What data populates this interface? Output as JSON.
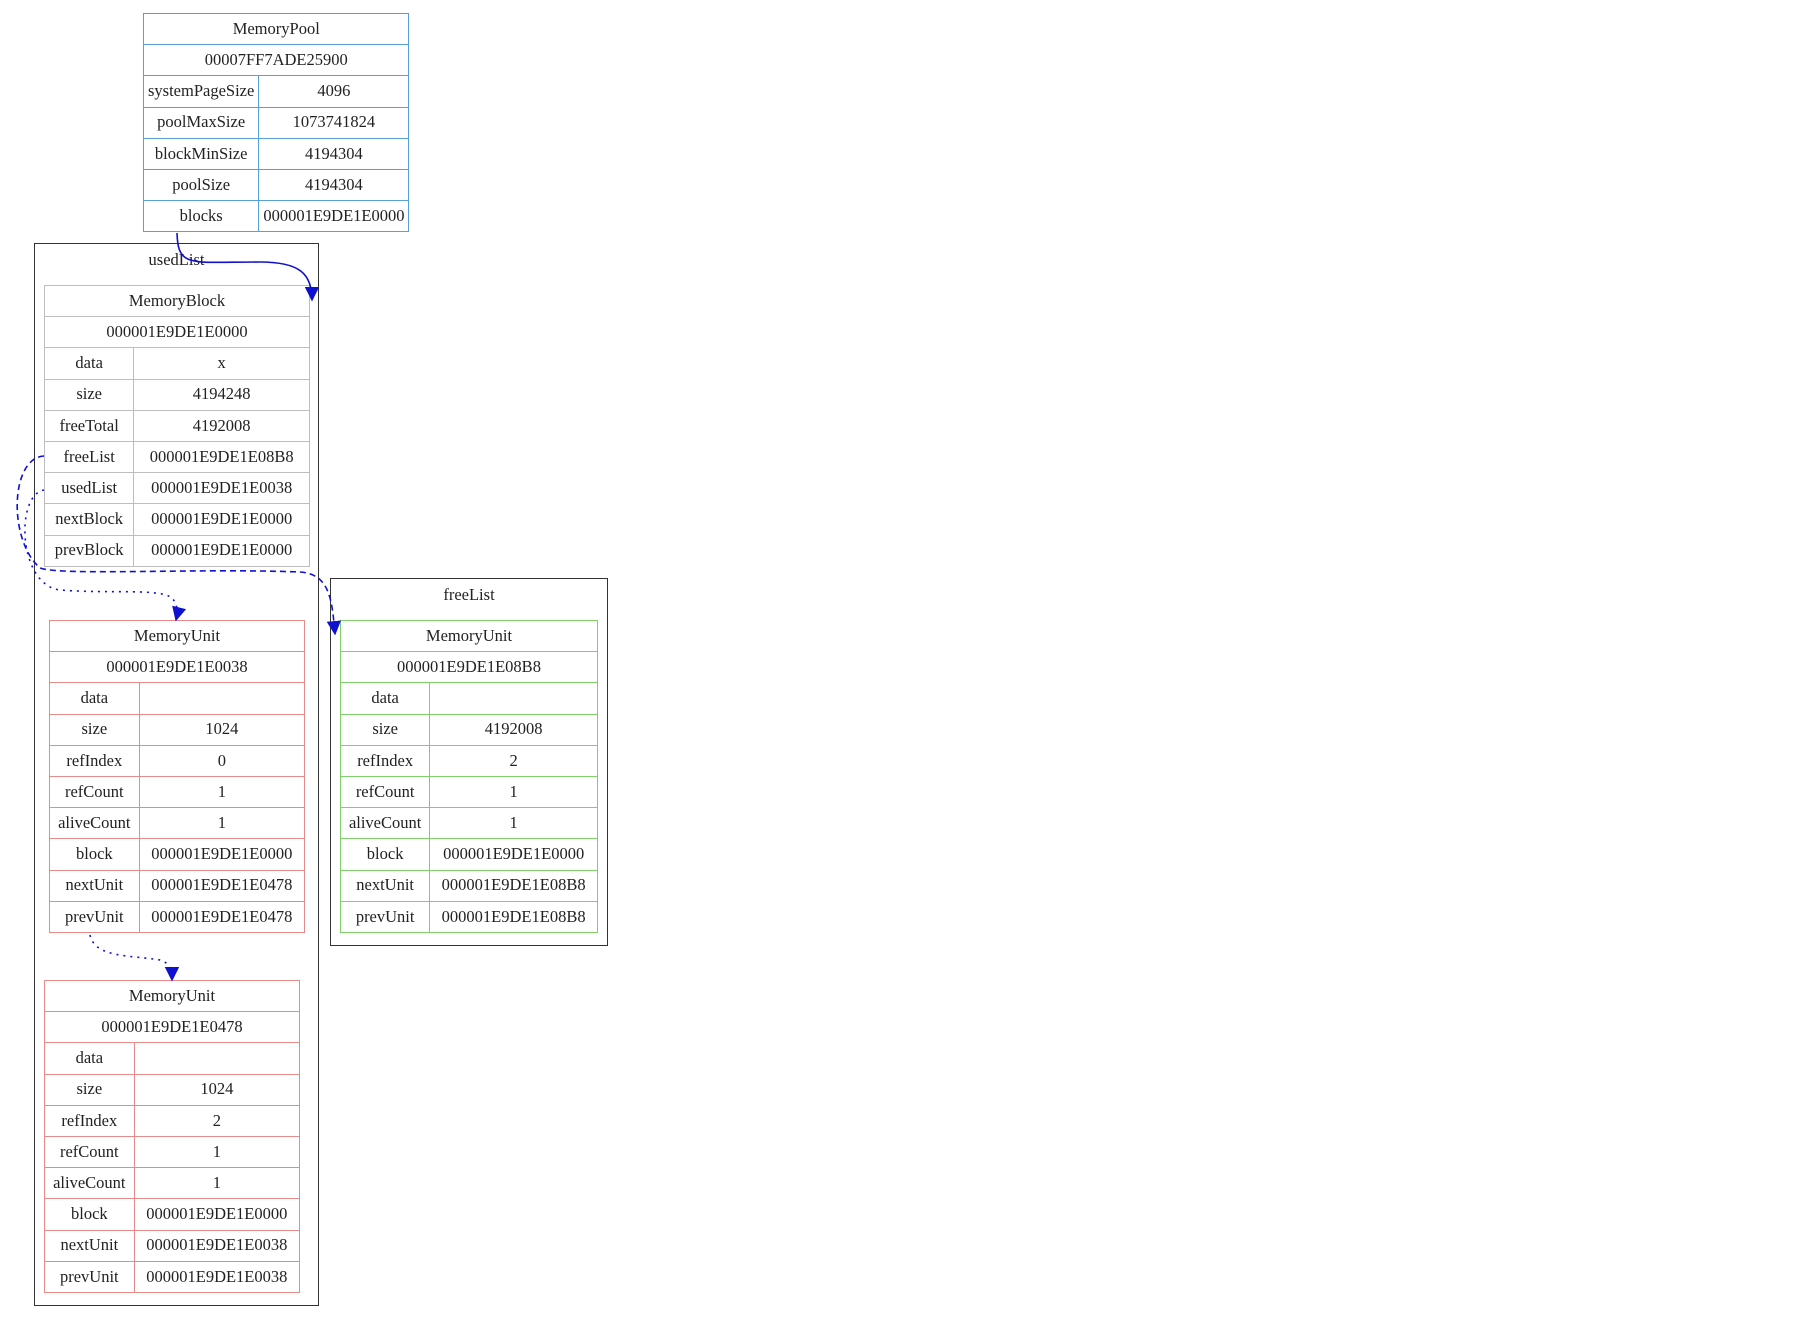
{
  "colors": {
    "pool_border": "#5aa0d8",
    "used_border": "#e88a8a",
    "free_border": "#7fcf6a",
    "edge": "#1010d0",
    "cluster_border": "#333333"
  },
  "pool": {
    "title": "MemoryPool",
    "address": "00007FF7ADE25900",
    "fields": [
      {
        "name": "systemPageSize",
        "value": "4096"
      },
      {
        "name": "poolMaxSize",
        "value": "1073741824"
      },
      {
        "name": "blockMinSize",
        "value": "4194304"
      },
      {
        "name": "poolSize",
        "value": "4194304"
      },
      {
        "name": "blocks",
        "value": "000001E9DE1E0000"
      }
    ]
  },
  "used_cluster": {
    "label": "usedList"
  },
  "free_cluster": {
    "label": "freeList"
  },
  "block": {
    "title": "MemoryBlock",
    "address": "000001E9DE1E0000",
    "fields": [
      {
        "name": "data",
        "value": "x"
      },
      {
        "name": "size",
        "value": "4194248"
      },
      {
        "name": "freeTotal",
        "value": "4192008"
      },
      {
        "name": "freeList",
        "value": "000001E9DE1E08B8"
      },
      {
        "name": "usedList",
        "value": "000001E9DE1E0038"
      },
      {
        "name": "nextBlock",
        "value": "000001E9DE1E0000"
      },
      {
        "name": "prevBlock",
        "value": "000001E9DE1E0000"
      }
    ]
  },
  "used_unit_1": {
    "title": "MemoryUnit",
    "address": "000001E9DE1E0038",
    "fields": [
      {
        "name": "data",
        "value": ""
      },
      {
        "name": "size",
        "value": "1024"
      },
      {
        "name": "refIndex",
        "value": "0"
      },
      {
        "name": "refCount",
        "value": "1"
      },
      {
        "name": "aliveCount",
        "value": "1"
      },
      {
        "name": "block",
        "value": "000001E9DE1E0000"
      },
      {
        "name": "nextUnit",
        "value": "000001E9DE1E0478"
      },
      {
        "name": "prevUnit",
        "value": "000001E9DE1E0478"
      }
    ]
  },
  "used_unit_2": {
    "title": "MemoryUnit",
    "address": "000001E9DE1E0478",
    "fields": [
      {
        "name": "data",
        "value": ""
      },
      {
        "name": "size",
        "value": "1024"
      },
      {
        "name": "refIndex",
        "value": "2"
      },
      {
        "name": "refCount",
        "value": "1"
      },
      {
        "name": "aliveCount",
        "value": "1"
      },
      {
        "name": "block",
        "value": "000001E9DE1E0000"
      },
      {
        "name": "nextUnit",
        "value": "000001E9DE1E0038"
      },
      {
        "name": "prevUnit",
        "value": "000001E9DE1E0038"
      }
    ]
  },
  "free_unit": {
    "title": "MemoryUnit",
    "address": "000001E9DE1E08B8",
    "fields": [
      {
        "name": "data",
        "value": ""
      },
      {
        "name": "size",
        "value": "4192008"
      },
      {
        "name": "refIndex",
        "value": "2"
      },
      {
        "name": "refCount",
        "value": "1"
      },
      {
        "name": "aliveCount",
        "value": "1"
      },
      {
        "name": "block",
        "value": "000001E9DE1E0000"
      },
      {
        "name": "nextUnit",
        "value": "000001E9DE1E08B8"
      },
      {
        "name": "prevUnit",
        "value": "000001E9DE1E08B8"
      }
    ]
  }
}
